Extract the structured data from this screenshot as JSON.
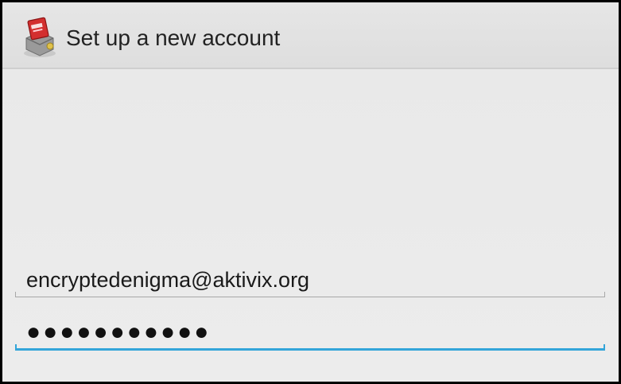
{
  "action_bar": {
    "title": "Set up a new account",
    "icon": "mail-app-icon"
  },
  "form": {
    "email": {
      "value": "encryptedenigma@aktivix.org"
    },
    "password": {
      "masked_value": "●●●●●●●●●●●",
      "focused": true
    }
  },
  "colors": {
    "accent": "#33a5d9",
    "background": "#ebebeb",
    "action_bar": "#e2e2e2",
    "text": "#1a1a1a"
  }
}
